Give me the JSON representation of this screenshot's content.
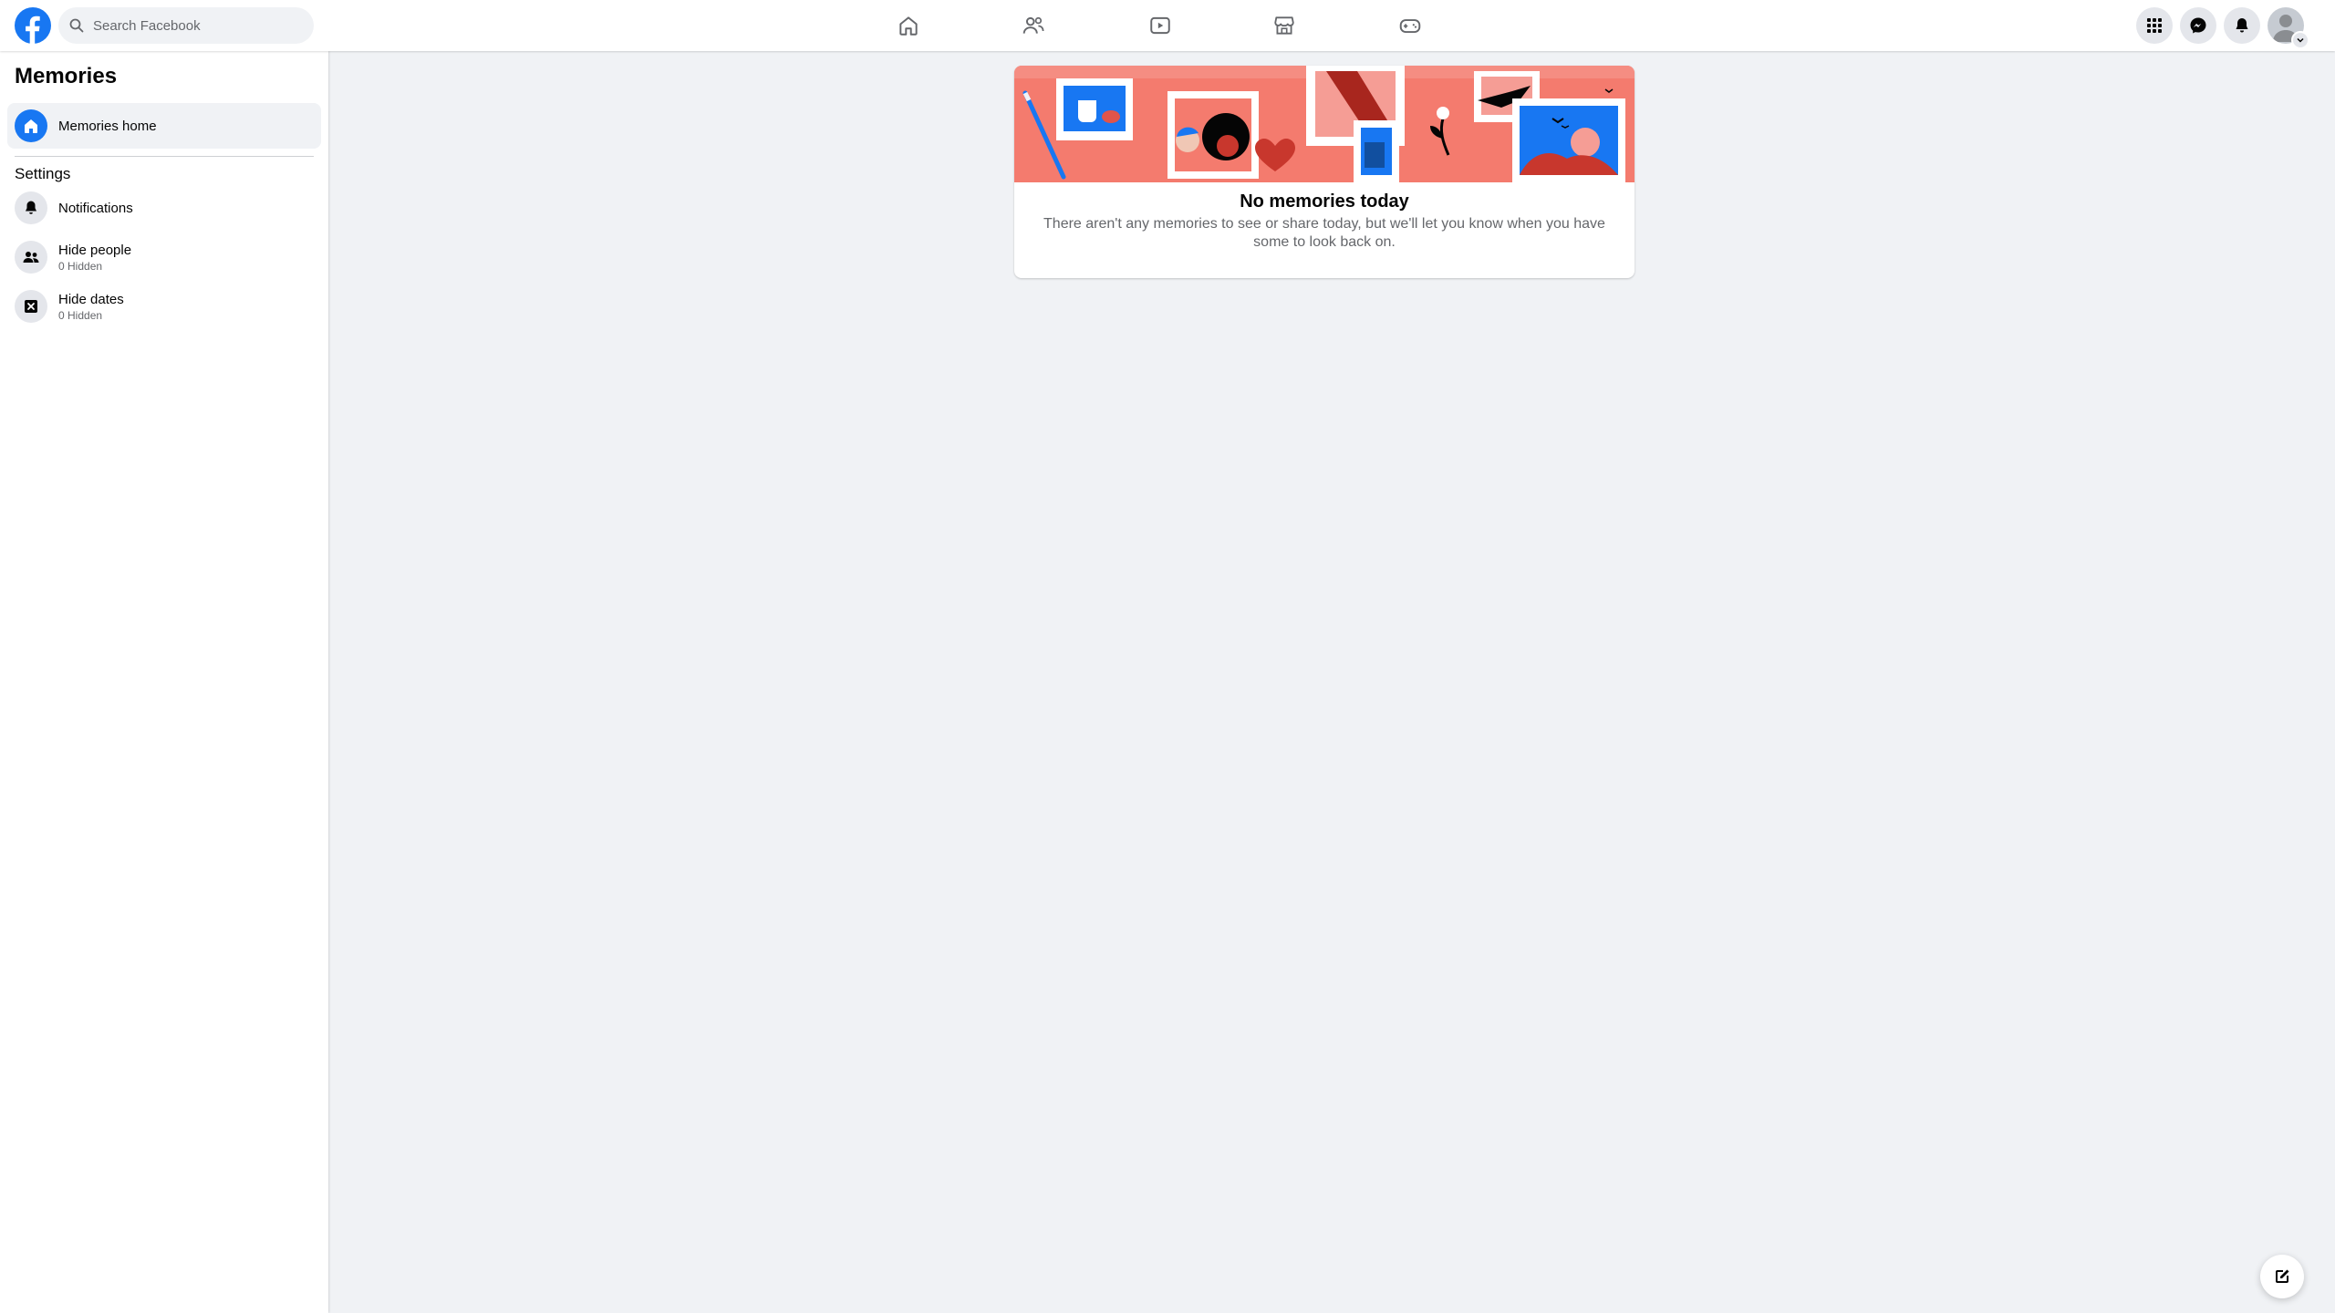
{
  "header": {
    "search_placeholder": "Search Facebook",
    "nav": [
      {
        "name": "home",
        "icon": "home-icon"
      },
      {
        "name": "friends",
        "icon": "friends-icon"
      },
      {
        "name": "video",
        "icon": "video-icon"
      },
      {
        "name": "marketplace",
        "icon": "marketplace-icon"
      },
      {
        "name": "gaming",
        "icon": "gaming-icon"
      }
    ],
    "right_buttons": [
      "menu-grid-icon",
      "messenger-icon",
      "bell-icon",
      "avatar"
    ]
  },
  "sidebar": {
    "title": "Memories",
    "items": [
      {
        "label": "Memories home",
        "icon": "home-icon",
        "active": true
      }
    ],
    "settings_label": "Settings",
    "settings_items": [
      {
        "label": "Notifications",
        "sub": "",
        "icon": "bell-icon"
      },
      {
        "label": "Hide people",
        "sub": "0 Hidden",
        "icon": "people-icon"
      },
      {
        "label": "Hide dates",
        "sub": "0 Hidden",
        "icon": "calendar-x-icon"
      }
    ]
  },
  "main": {
    "card_title": "No memories today",
    "card_body": "There aren't any memories to see or share today, but we'll let you know when you have some to look back on."
  },
  "colors": {
    "brand_blue": "#1877f2",
    "banner_salmon": "#f47b6e",
    "page_bg": "#f0f2f5"
  }
}
